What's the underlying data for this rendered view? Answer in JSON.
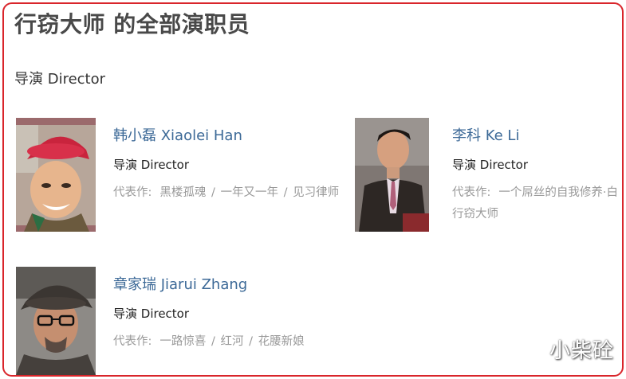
{
  "page": {
    "title": "行窃大师 的全部演职员",
    "section": "导演 Director"
  },
  "people": [
    {
      "name": "韩小磊 Xiaolei Han",
      "role": "导演 Director",
      "works_label": "代表作:",
      "works": [
        "黑楼孤魂",
        "一年又一年",
        "见习律师"
      ]
    },
    {
      "name": "李科 Ke Li",
      "role": "导演 Director",
      "works_label": "代表作:",
      "works": [
        "一个屌丝的自我修养·白",
        "行窃大师"
      ]
    },
    {
      "name": "章家瑞 Jiarui Zhang",
      "role": "导演 Director",
      "works_label": "代表作:",
      "works": [
        "一路惊喜",
        "红河",
        "花腰新娘"
      ]
    }
  ],
  "watermark": "小柴砼",
  "colors": {
    "frame": "#d9252b",
    "link": "#3c6997",
    "muted": "#999999"
  }
}
